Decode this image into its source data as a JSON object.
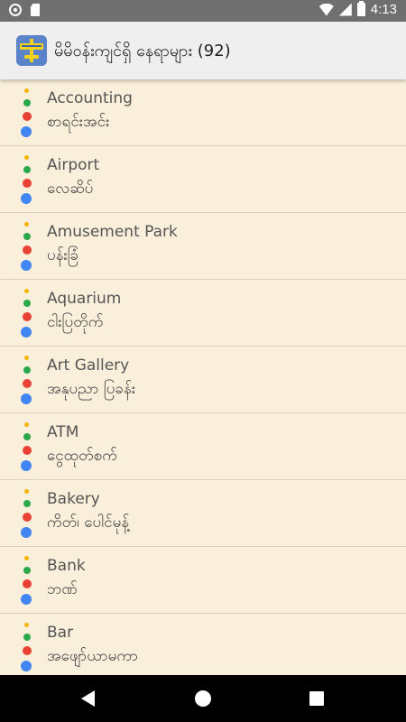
{
  "status_bar": {
    "time": "4:13",
    "icons": [
      "record-icon",
      "sd-card-icon",
      "wifi-icon",
      "signal-icon",
      "battery-icon"
    ]
  },
  "app_bar": {
    "title": "မိမိဝန်းကျင်ရှိ နေရာများ (92)",
    "icon": "app-logo-icon"
  },
  "colors": {
    "dot_yellow": "#f5b400",
    "dot_green": "#2aa84a",
    "dot_red": "#e94235",
    "dot_blue": "#4285f4",
    "background": "#f9efdb"
  },
  "places": [
    {
      "name": "Accounting",
      "myanmar": "စာရင်းအင်း"
    },
    {
      "name": "Airport",
      "myanmar": "လေဆိပ်"
    },
    {
      "name": "Amusement Park",
      "myanmar": "ပန်းခြံ"
    },
    {
      "name": "Aquarium",
      "myanmar": "ငါးပြတိုက်"
    },
    {
      "name": "Art Gallery",
      "myanmar": "အနုပညာ ပြခန်း"
    },
    {
      "name": "ATM",
      "myanmar": "ငွေထုတ်စက်"
    },
    {
      "name": "Bakery",
      "myanmar": "ကိတ်၊ ပေါင်မုန့်"
    },
    {
      "name": "Bank",
      "myanmar": "ဘဏ်"
    },
    {
      "name": "Bar",
      "myanmar": "အဖျော်ယာမကာ"
    }
  ],
  "nav_bar": {
    "icons": [
      "back-icon",
      "home-icon",
      "recents-icon"
    ]
  }
}
